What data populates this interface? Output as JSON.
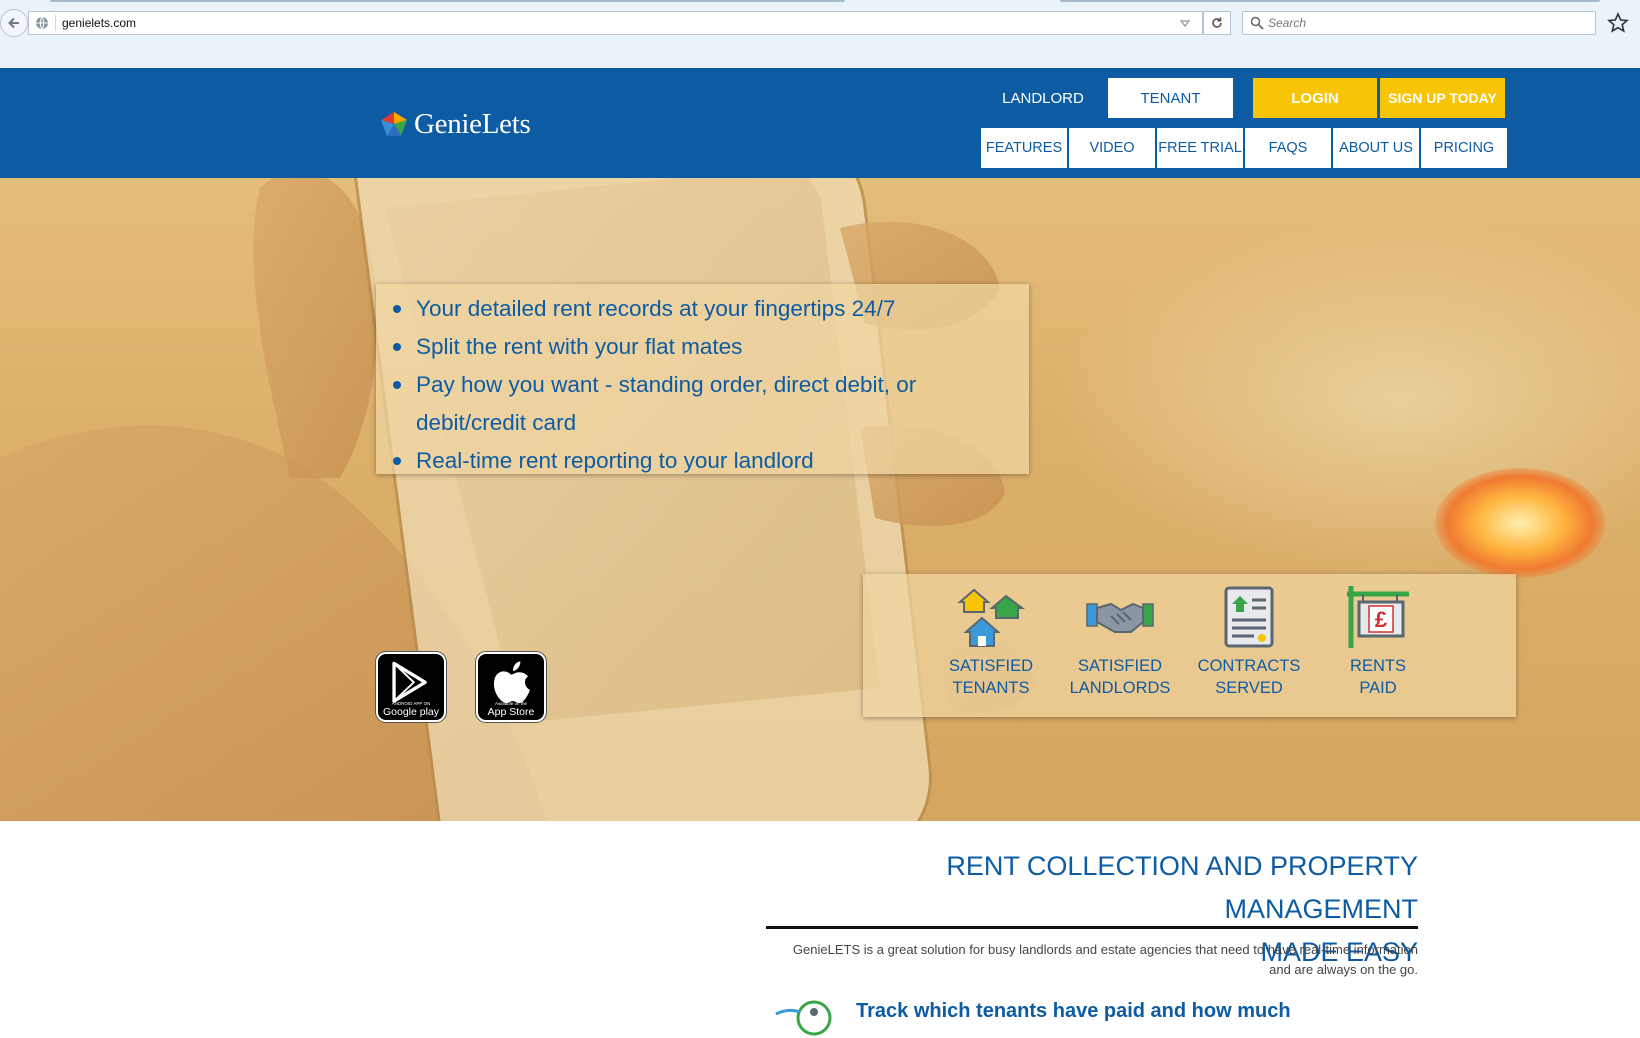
{
  "browser": {
    "url": "genielets.com",
    "search_placeholder": "Search"
  },
  "header": {
    "brand": "GenieLets",
    "roles": {
      "landlord": "LANDLORD",
      "tenant": "TENANT"
    },
    "login": "LOGIN",
    "signup": "SIGN UP TODAY",
    "nav": [
      "FEATURES",
      "VIDEO",
      "FREE TRIAL",
      "FAQS",
      "ABOUT US",
      "PRICING"
    ],
    "colors": {
      "brand_blue": "#0d5ca3",
      "accent_yellow": "#f7c505"
    }
  },
  "hero": {
    "bullets": [
      "Your detailed rent records at your fingertips 24/7",
      "Split the rent with your flat mates",
      "Pay how you want - standing order, direct debit, or debit/credit card",
      "Real-time rent reporting to your landlord"
    ],
    "apps": {
      "google": {
        "small": "ANDROID APP ON",
        "caption": "Google play"
      },
      "apple": {
        "small": "Available on the",
        "caption": "App Store"
      }
    },
    "stats": [
      {
        "line1": "SATISFIED",
        "line2": "TENANTS",
        "icon": "houses-icon"
      },
      {
        "line1": "SATISFIED",
        "line2": "LANDLORDS",
        "icon": "handshake-icon"
      },
      {
        "line1": "CONTRACTS",
        "line2": "SERVED",
        "icon": "contract-icon"
      },
      {
        "line1": "RENTS",
        "line2": "PAID",
        "icon": "pound-sign-icon"
      }
    ]
  },
  "main": {
    "tagline_line1": "RENT COLLECTION AND PROPERTY MANAGEMENT",
    "tagline_line2": "MADE EASY",
    "intro_line1": "GenieLETS is a great solution for busy landlords and estate agencies   that need to have real-time information",
    "intro_line2": "and are always on the go.",
    "feature_partial": "Track which tenants have paid and how much"
  }
}
